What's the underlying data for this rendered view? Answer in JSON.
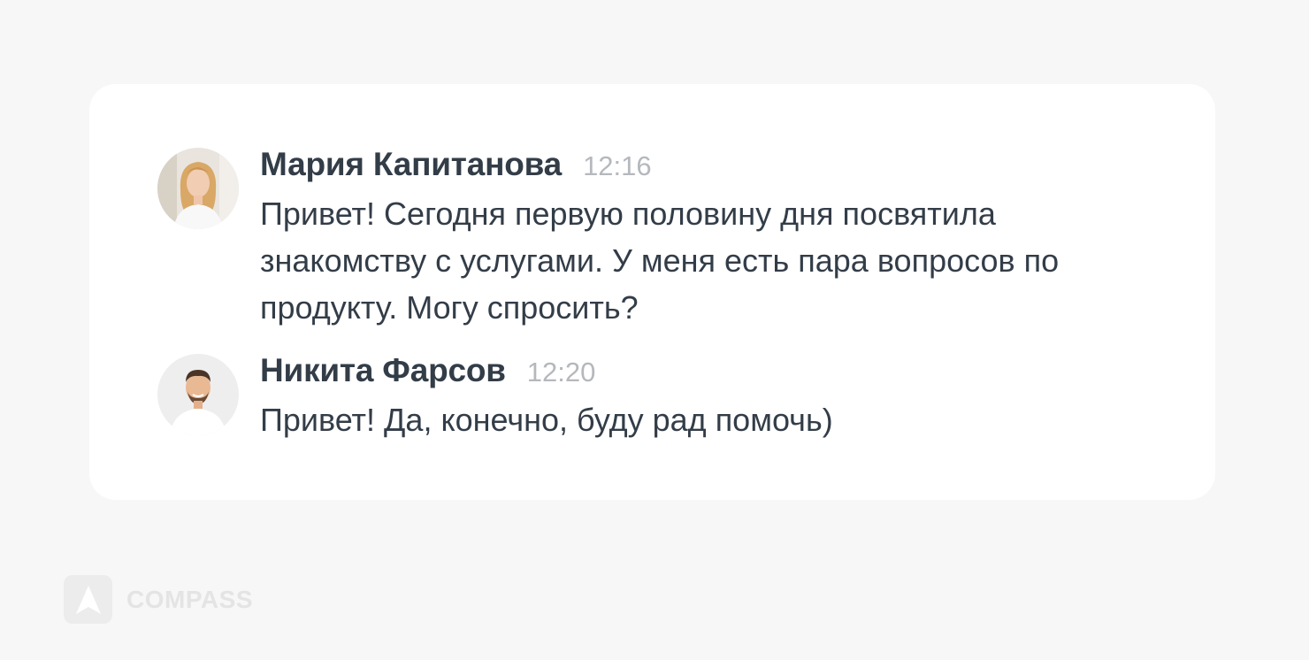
{
  "messages": [
    {
      "author": "Мария Капитанова",
      "time": "12:16",
      "text": "Привет! Сегодня первую половину дня посвятила знакомству с услугами. У меня есть пара вопросов по продукту. Могу спросить?"
    },
    {
      "author": "Никита Фарсов",
      "time": "12:20",
      "text": "Привет! Да, конечно, буду рад помочь)"
    }
  ],
  "brand": {
    "name": "COMPASS",
    "icon": "compass-logo-icon"
  },
  "colors": {
    "page_background": "#f7f7f7",
    "card_background": "#ffffff",
    "author_text": "#333d48",
    "time_text": "#b5b8bc",
    "brand_text": "#e4e4e4"
  }
}
